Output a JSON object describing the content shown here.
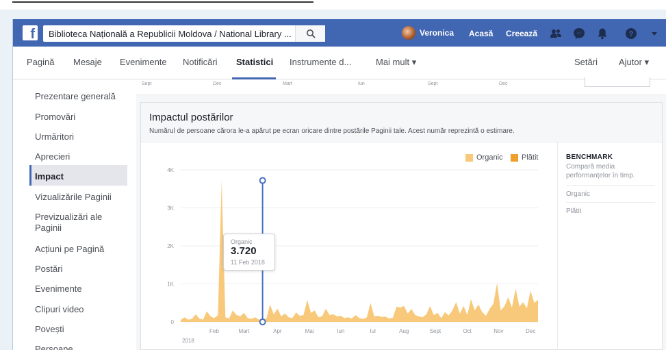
{
  "search": {
    "value": "Biblioteca Națională a Republicii Moldova / National Library ..."
  },
  "topbar": {
    "user_name": "Veronica",
    "home_label": "Acasă",
    "create_label": "Creează"
  },
  "tabs": [
    {
      "label": "Pagină"
    },
    {
      "label": "Mesaje"
    },
    {
      "label": "Evenimente"
    },
    {
      "label": "Notificări"
    },
    {
      "label": "Statistici"
    },
    {
      "label": "Instrumente d..."
    },
    {
      "label": "Mai mult ▾"
    },
    {
      "label": "Setări"
    },
    {
      "label": "Ajutor ▾"
    }
  ],
  "sidebar": {
    "items": [
      {
        "label": "Prezentare generală"
      },
      {
        "label": "Promovări"
      },
      {
        "label": "Urmăritori"
      },
      {
        "label": "Aprecieri"
      },
      {
        "label": "Impact"
      },
      {
        "label": "Vizualizările Paginii"
      },
      {
        "label": "Previzualizări ale Paginii"
      },
      {
        "label": "Acțiuni pe Pagină"
      },
      {
        "label": "Postări"
      },
      {
        "label": "Evenimente"
      },
      {
        "label": "Clipuri video"
      },
      {
        "label": "Povești"
      },
      {
        "label": "Persoane"
      }
    ]
  },
  "previous_chart": {
    "ticks": [
      "Sept",
      "Dec",
      "Mart",
      "Iun",
      "Sept",
      "Dec"
    ]
  },
  "panel": {
    "title": "Impactul postărilor",
    "subtitle": "Numărul de persoane cărora le-a apărut pe ecran oricare dintre postările Paginii tale. Acest număr reprezintă o estimare."
  },
  "legend": [
    {
      "label": "Organic",
      "color": "#f8c97a"
    },
    {
      "label": "Plătit",
      "color": "#f0a02a"
    }
  ],
  "tooltip": {
    "label": "Organic",
    "value": "3.720",
    "date": "11 Feb 2018"
  },
  "benchmark": {
    "title": "BENCHMARK",
    "description": "Compară media performanțelor în timp.",
    "rows": [
      "Organic",
      "Plătit"
    ]
  },
  "colors": {
    "brand": "#4267b2",
    "organic": "#f8c97a",
    "paid": "#f0a02a",
    "marker": "#4a72c4"
  },
  "chart_data": {
    "type": "area",
    "x_tick_labels": [
      "Feb",
      "Mart",
      "Apr",
      "Mai",
      "Iun",
      "Iul",
      "Aug",
      "Sept",
      "Oct",
      "Nov",
      "Dec"
    ],
    "year_label": "2018",
    "y_tick_labels": [
      "0",
      "1K",
      "2K",
      "3K",
      "4K"
    ],
    "ylim": [
      0,
      4000
    ],
    "x_range": [
      0,
      48
    ],
    "x_tick_positions": [
      4.5,
      8.5,
      13,
      17.3,
      21.5,
      25.8,
      30,
      34.2,
      38.5,
      42.7,
      47
    ],
    "grid": true,
    "series": [
      {
        "name": "Organic",
        "x": [
          0,
          0.5,
          1,
          1.5,
          2,
          2.5,
          3,
          3.5,
          4,
          4.5,
          5,
          5.5,
          6,
          6.5,
          7,
          7.5,
          8,
          8.5,
          9,
          9.5,
          10,
          10.5,
          11,
          11.5,
          12,
          12.5,
          13,
          13.5,
          14,
          14.5,
          15,
          15.5,
          16,
          16.5,
          17,
          17.5,
          18,
          18.5,
          19,
          19.5,
          20,
          20.5,
          21,
          21.5,
          22,
          22.5,
          23,
          23.5,
          24,
          24.5,
          25,
          25.5,
          26,
          26.5,
          27,
          27.5,
          28,
          28.5,
          29,
          29.5,
          30,
          30.5,
          31,
          31.5,
          32,
          32.5,
          33,
          33.5,
          34,
          34.5,
          35,
          35.5,
          36,
          36.5,
          37,
          37.5,
          38,
          38.5,
          39,
          39.5,
          40,
          40.5,
          41,
          41.5,
          42,
          42.5,
          43,
          43.5,
          44,
          44.5,
          45,
          45.5,
          46,
          46.5,
          47,
          47.5,
          48
        ],
        "values": [
          50,
          120,
          60,
          80,
          200,
          90,
          60,
          280,
          150,
          100,
          180,
          3720,
          120,
          90,
          300,
          180,
          150,
          240,
          100,
          80,
          120,
          60,
          90,
          80,
          460,
          200,
          350,
          150,
          220,
          120,
          100,
          250,
          160,
          180,
          580,
          240,
          300,
          120,
          150,
          350,
          180,
          200,
          150,
          160,
          100,
          120,
          90,
          180,
          100,
          80,
          120,
          500,
          150,
          160,
          130,
          140,
          90,
          110,
          400,
          380,
          420,
          220,
          340,
          180,
          150,
          120,
          200,
          420,
          180,
          240,
          100,
          260,
          170,
          300,
          520,
          220,
          420,
          180,
          600,
          300,
          460,
          260,
          160,
          340,
          480,
          1020,
          300,
          420,
          650,
          380,
          880,
          400,
          520,
          360,
          820,
          500,
          580
        ]
      },
      {
        "name": "Plătit",
        "values": []
      }
    ],
    "highlight": {
      "x": 11,
      "value": 3720,
      "date": "11 Feb 2018"
    }
  }
}
